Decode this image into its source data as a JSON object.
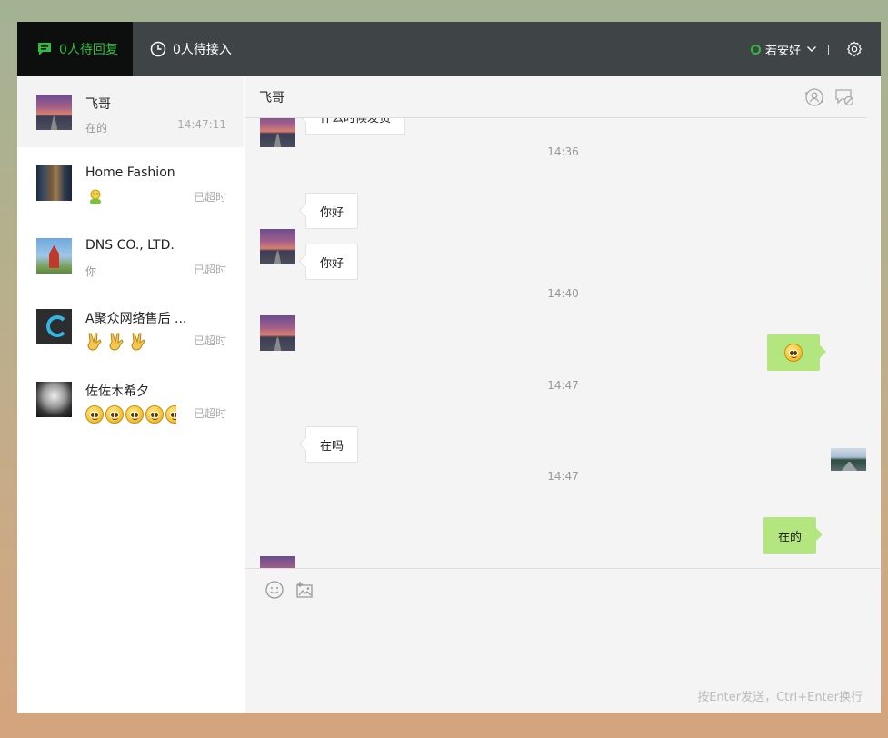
{
  "topbar": {
    "tab_pending_reply": "0人待回复",
    "tab_pending_accept": "0人待接入",
    "status_name": "若安好",
    "colors": {
      "accent": "#2fbd3e",
      "bar": "#3f4547",
      "active_tab": "#0c0f0e"
    }
  },
  "conversations": [
    {
      "name": "飞哥",
      "preview": "在的",
      "time": "14:47:11",
      "active": true,
      "avatar": "sunset"
    },
    {
      "name": "Home Fashion",
      "preview_icon": "person-emoji",
      "time": "已超时",
      "avatar": "home"
    },
    {
      "name": "DNS CO., LTD.",
      "preview": "你",
      "time": "已超时",
      "avatar": "church"
    },
    {
      "name": "A聚众网络售后 ...",
      "preview_icon": "victory-emoji-x3",
      "time": "已超时",
      "avatar": "logo"
    },
    {
      "name": "佐佐木希夕",
      "preview_icon": "smiley-emoji-x4",
      "time": "已超时",
      "avatar": "person"
    }
  ],
  "chat": {
    "title": "飞哥",
    "messages": [
      {
        "type": "text",
        "side": "left",
        "text": "什么时候发货"
      },
      {
        "type": "time",
        "text": "14:36"
      },
      {
        "type": "text",
        "side": "left",
        "text": "你好"
      },
      {
        "type": "text",
        "side": "left",
        "text": "你好"
      },
      {
        "type": "time",
        "text": "14:40"
      },
      {
        "type": "emoji",
        "side": "right",
        "icon": "smiley-emoji"
      },
      {
        "type": "time",
        "text": "14:47"
      },
      {
        "type": "text",
        "side": "left",
        "text": "在吗"
      },
      {
        "type": "time",
        "text": "14:47"
      },
      {
        "type": "text",
        "side": "right",
        "text": "在的"
      }
    ],
    "composer": {
      "hint": "按Enter发送，Ctrl+Enter换行",
      "tools": [
        "emoji-icon",
        "image-icon"
      ]
    }
  }
}
